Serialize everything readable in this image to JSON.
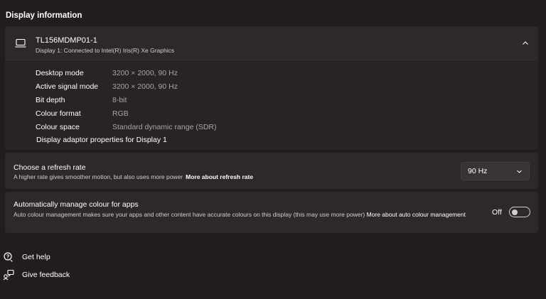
{
  "section_title": "Display information",
  "display": {
    "name": "TL156MDMP01-1",
    "connection": "Display 1: Connected to Intel(R) Iris(R) Xe Graphics",
    "details": [
      {
        "label": "Desktop mode",
        "value": "3200 × 2000, 90 Hz"
      },
      {
        "label": "Active signal mode",
        "value": "3200 × 2000, 90 Hz"
      },
      {
        "label": "Bit depth",
        "value": "8-bit"
      },
      {
        "label": "Colour format",
        "value": "RGB"
      },
      {
        "label": "Colour space",
        "value": "Standard dynamic range (SDR)"
      }
    ],
    "adaptor_link": "Display adaptor properties for Display 1"
  },
  "refresh_rate": {
    "title": "Choose a refresh rate",
    "description": "A higher rate gives smoother motion, but also uses more power",
    "link": "More about refresh rate",
    "selected": "90 Hz"
  },
  "auto_colour": {
    "title": "Automatically manage colour for apps",
    "description": "Auto colour management makes sure your apps and other content have accurate colours on this display (this may use more power)",
    "link": "More about auto colour management",
    "toggle_label": "Off",
    "toggle_on": false
  },
  "footer": {
    "help": "Get help",
    "feedback": "Give feedback"
  },
  "icons": {
    "monitor": "laptop-icon",
    "expand": "chevron-up-icon",
    "dropdown": "chevron-down-icon",
    "help": "help-icon",
    "feedback": "feedback-icon"
  }
}
